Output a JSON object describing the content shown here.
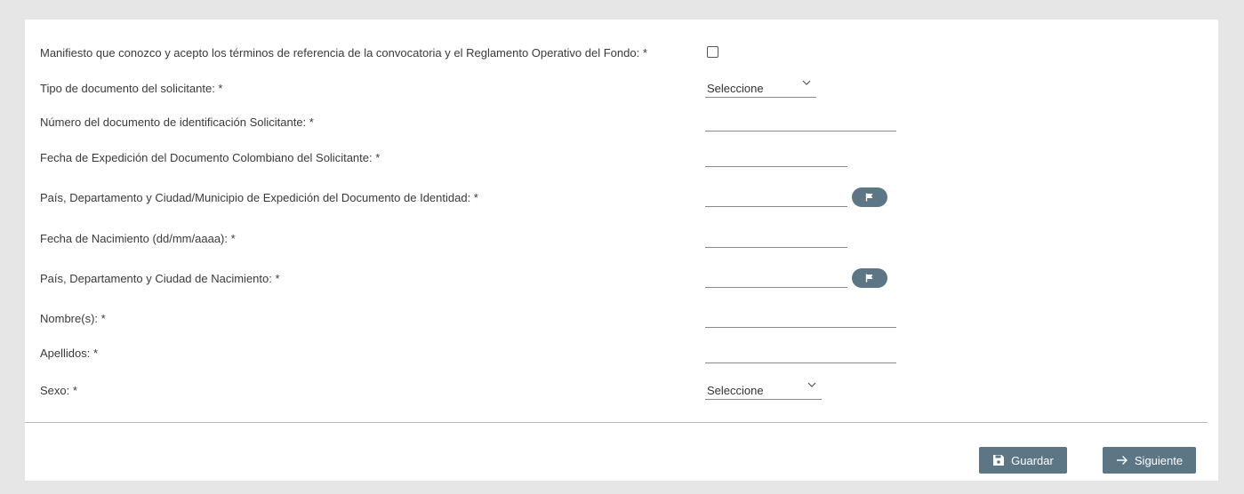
{
  "form": {
    "fields": [
      {
        "label": "Manifiesto que conozco y acepto los términos de referencia de la convocatoria y el Reglamento Operativo del Fondo: *",
        "type": "checkbox",
        "checked": false
      },
      {
        "label": "Tipo de documento del solicitante: *",
        "type": "select",
        "value": "Seleccione"
      },
      {
        "label": "Número del documento de identificación Solicitante: *",
        "type": "text",
        "value": ""
      },
      {
        "label": "Fecha de Expedición del Documento Colombiano del Solicitante: *",
        "type": "date",
        "value": ""
      },
      {
        "label": "País, Departamento y Ciudad/Municipio de Expedición del Documento de Identidad: *",
        "type": "location",
        "value": "",
        "icon": "flag-icon"
      },
      {
        "label": "Fecha de Nacimiento (dd/mm/aaaa): *",
        "type": "date",
        "value": ""
      },
      {
        "label": "País, Departamento y Ciudad de Nacimiento: *",
        "type": "location",
        "value": "",
        "icon": "flag-icon"
      },
      {
        "label": "Nombre(s): *",
        "type": "text",
        "value": ""
      },
      {
        "label": "Apellidos: *",
        "type": "text",
        "value": ""
      },
      {
        "label": "Sexo: *",
        "type": "select",
        "value": "Seleccione"
      }
    ]
  },
  "actions": {
    "save_label": "Guardar",
    "save_icon": "save-icon",
    "next_label": "Siguiente",
    "next_icon": "arrow-right-icon"
  },
  "colors": {
    "button": "#5c7686",
    "background": "#e6e6e6",
    "card": "#ffffff"
  }
}
